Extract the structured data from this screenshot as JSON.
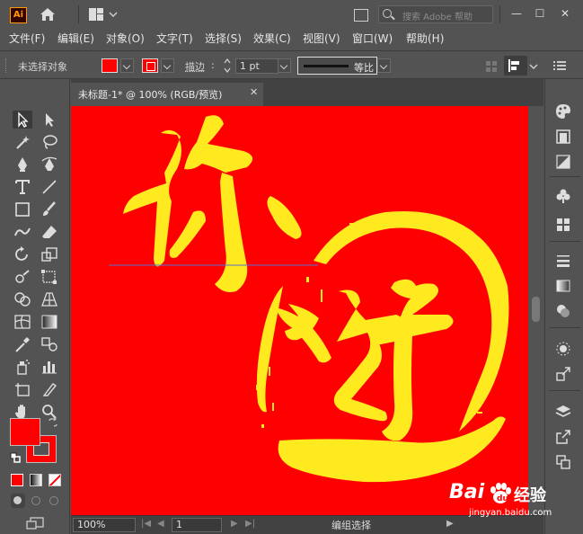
{
  "app": {
    "logo_text": "Ai",
    "search_placeholder": "搜索 Adobe 帮助",
    "window_buttons": [
      "—",
      "☐",
      "✕"
    ]
  },
  "menu": {
    "items": [
      "文件(F)",
      "编辑(E)",
      "对象(O)",
      "文字(T)",
      "选择(S)",
      "效果(C)",
      "视图(V)",
      "窗口(W)",
      "帮助(H)"
    ]
  },
  "control_bar": {
    "selection_status": "未选择对象",
    "fill_color": "#ff0000",
    "stroke_color": "#ff0000",
    "stroke_label": "描边",
    "stroke_weight": "1 pt",
    "brush_label": "等比"
  },
  "document": {
    "tab_title": "未标题-1* @ 100% (RGB/预览)",
    "close_label": "✕",
    "canvas_color": "#ff0000",
    "artwork_color": "#ffe91f"
  },
  "statusbar": {
    "zoom": "100%",
    "page": "1",
    "status": "编组选择"
  },
  "watermark": {
    "brand": "Bai",
    "brand_tail": "经验",
    "url": "jingyan.baidu.com"
  }
}
